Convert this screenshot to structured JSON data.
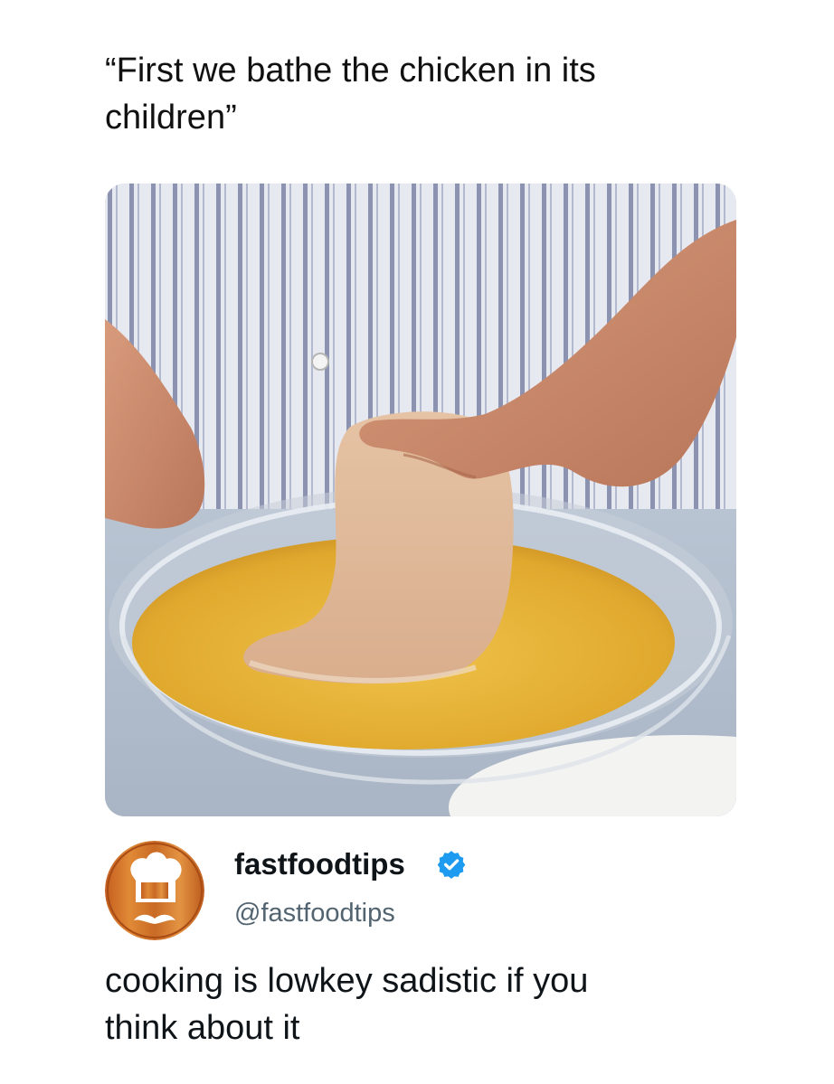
{
  "caption": {
    "line1": "“First we bathe the chicken in its",
    "line2": "children”"
  },
  "photo": {
    "icon": "chicken-egg-wash-photo"
  },
  "author": {
    "display_name": "fastfoodtips",
    "handle": "@fastfoodtips",
    "verified": true,
    "avatar_icon": "chef-hat-mustache-icon",
    "verified_icon": "verified-badge-icon",
    "colors": {
      "avatar_ring": "#d8772a",
      "verified": "#1d9bf0",
      "handle": "#536471"
    }
  },
  "tweet": {
    "line1": "cooking is lowkey sadistic if you",
    "line2": "think about it"
  }
}
